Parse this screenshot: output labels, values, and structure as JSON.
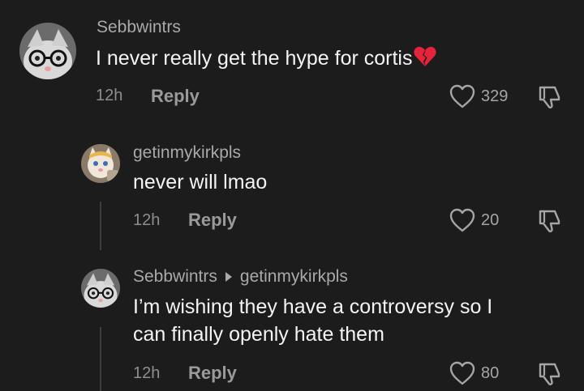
{
  "comments": [
    {
      "username": "Sebbwintrs",
      "text": "I never really get the hype for cortis",
      "emoji": "broken-heart-emoji",
      "time": "12h",
      "reply_label": "Reply",
      "likes": "329",
      "avatar": "cat-with-glasses-avatar"
    },
    {
      "username": "getinmykirkpls",
      "text": "never will lmao",
      "time": "12h",
      "reply_label": "Reply",
      "likes": "20",
      "avatar": "talking-angela-avatar"
    },
    {
      "username": "Sebbwintrs",
      "reply_to": "getinmykirkpls",
      "text_line1": "I’m wishing they have a controversy so I",
      "text_line2": "can finally openly hate them",
      "time": "12h",
      "reply_label": "Reply",
      "likes": "80",
      "avatar": "cat-with-glasses-avatar"
    }
  ],
  "colors": {
    "background": "#1c1c1c",
    "primary_text": "#f4f4f4",
    "secondary_text": "#a9a9a9",
    "broken_heart": "#e5233a"
  }
}
